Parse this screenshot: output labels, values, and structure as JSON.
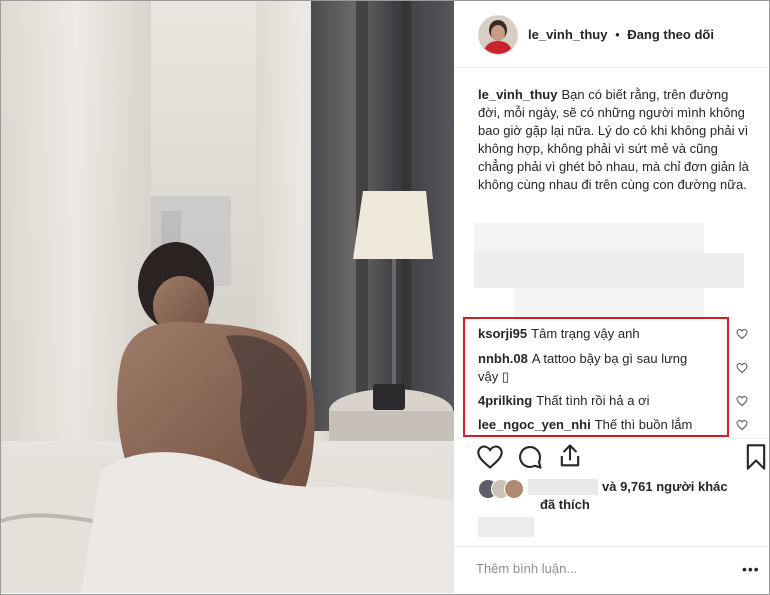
{
  "header": {
    "username": "le_vinh_thuy",
    "separator": "•",
    "follow_status": "Đang theo dõi"
  },
  "caption": {
    "username": "le_vinh_thuy",
    "text": "Bạn có biết rằng, trên đường đời, mỗi ngày, sẽ có những người mình không bao giờ gặp lại nữa. Lý do có khi không phải vì không hợp, không phải vì sứt mẻ và cũng chẳng phải vì ghét bỏ nhau, mà chỉ đơn giản là không cùng nhau đi trên cùng con đường nữa."
  },
  "comments": [
    {
      "username": "ksorji95",
      "text": "Tâm trạng vậy anh"
    },
    {
      "username": "nnbh.08",
      "text": "A tattoo bậy bạ gì sau lưng vậy ▯"
    },
    {
      "username": "4prilking",
      "text": "Thất tình rồi hả a ơi"
    },
    {
      "username": "lee_ngoc_yen_nhi",
      "text": "Thế thì buồn lắm"
    }
  ],
  "likes": {
    "text": "và 9,761 người khác",
    "text2": "đã thích"
  },
  "comment_input": {
    "placeholder": "Thêm bình luận..."
  },
  "more_label": "•••",
  "icons": {
    "like": "heart-icon",
    "comment": "comment-icon",
    "share": "share-icon",
    "save": "bookmark-icon"
  },
  "colors": {
    "highlight_border": "#d11f2a",
    "text": "#262626",
    "muted": "#8e8e8e"
  }
}
